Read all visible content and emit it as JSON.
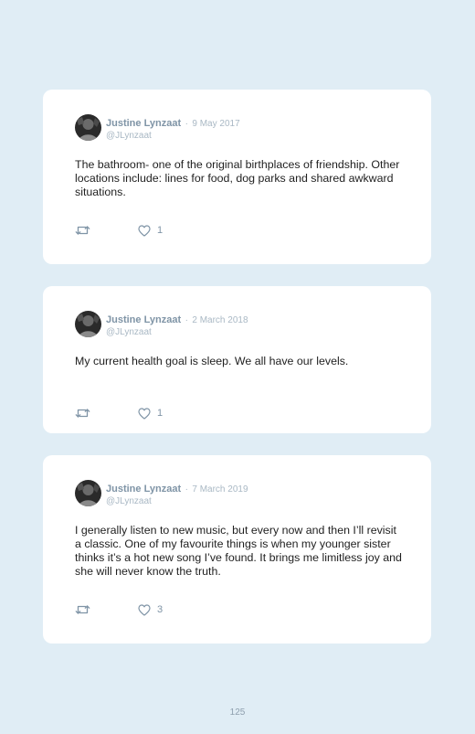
{
  "tweets": [
    {
      "author_name": "Justine Lynzaat",
      "separator": "·",
      "date": "9 May 2017",
      "handle": "@JLynzaat",
      "text": "The bathroom- one of the original birthplaces of friendship. Other locations include: lines for food, dog parks and shared awkward situations.",
      "like_count": "1"
    },
    {
      "author_name": "Justine Lynzaat",
      "separator": "·",
      "date": "2 March 2018",
      "handle": "@JLynzaat",
      "text": "My current health goal is sleep. We all have our levels.",
      "like_count": "1"
    },
    {
      "author_name": "Justine Lynzaat",
      "separator": "·",
      "date": "7 March 2019",
      "handle": "@JLynzaat",
      "text": "I generally listen to new music, but every now and then I’ll revisit a classic. One of my favourite things is when my younger sister thinks it’s a hot new song I’ve found. It brings me limitless joy and she will never know the truth.",
      "like_count": "3"
    }
  ],
  "icons": {
    "retweet": "retweet-icon",
    "like": "heart-icon",
    "avatar": "avatar"
  },
  "colors": {
    "background": "#e0edf5",
    "card": "#ffffff",
    "name": "#7f94a6",
    "muted": "#a9b8c4",
    "text": "#1f1f1f"
  },
  "page_number": "125"
}
